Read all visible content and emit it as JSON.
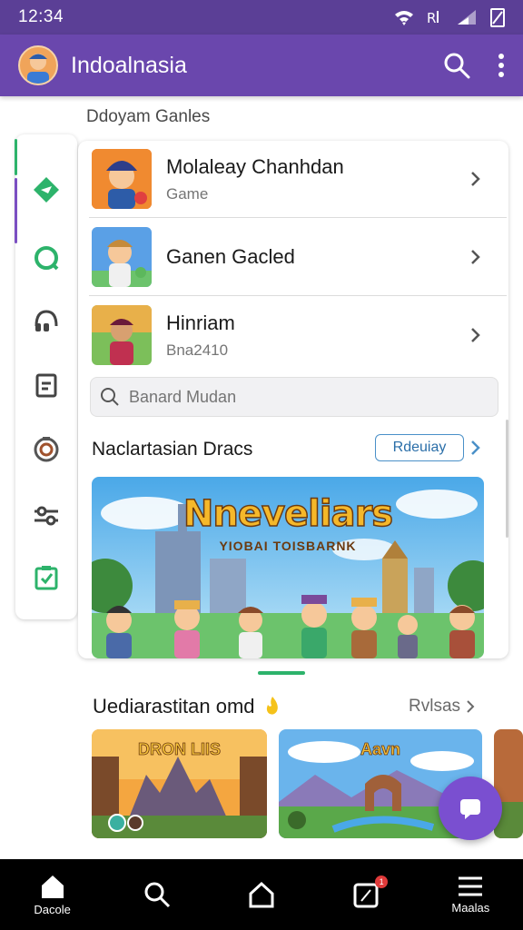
{
  "status_bar": {
    "time": "12:34"
  },
  "app_bar": {
    "title": "Indoalnasia"
  },
  "section_label": "Ddoyam Ganles",
  "list": [
    {
      "title": "Molaleay Chanhdan",
      "subtitle": "Game"
    },
    {
      "title": "Ganen Gacled",
      "subtitle": ""
    },
    {
      "title": "Hinriam",
      "subtitle": "Bna2410"
    }
  ],
  "search": {
    "placeholder": "Banard Mudan"
  },
  "featured": {
    "heading": "Naclartasian Dracs",
    "button_label": "Rdeuiay",
    "banner_title": "Nneveliars",
    "banner_subtitle": "YIOBAI TOISBARNK"
  },
  "section2": {
    "heading": "Uediarastitan omd",
    "more_label": "Rvlsas",
    "cards": [
      {
        "title": "DRON LIIS"
      },
      {
        "title": "Aavn"
      }
    ]
  },
  "bottom_nav": [
    {
      "label": "Dacole",
      "icon": "home-icon"
    },
    {
      "label": "",
      "icon": "search-icon"
    },
    {
      "label": "",
      "icon": "house-outline-icon"
    },
    {
      "label": "",
      "icon": "notification-icon",
      "badge": "1"
    },
    {
      "label": "Maalas",
      "icon": "menu-icon"
    }
  ],
  "colors": {
    "app_bar": "#6a47ad",
    "status_bar": "#5b3f96",
    "accent_green": "#2db36b",
    "fab": "#7a4fd0"
  }
}
